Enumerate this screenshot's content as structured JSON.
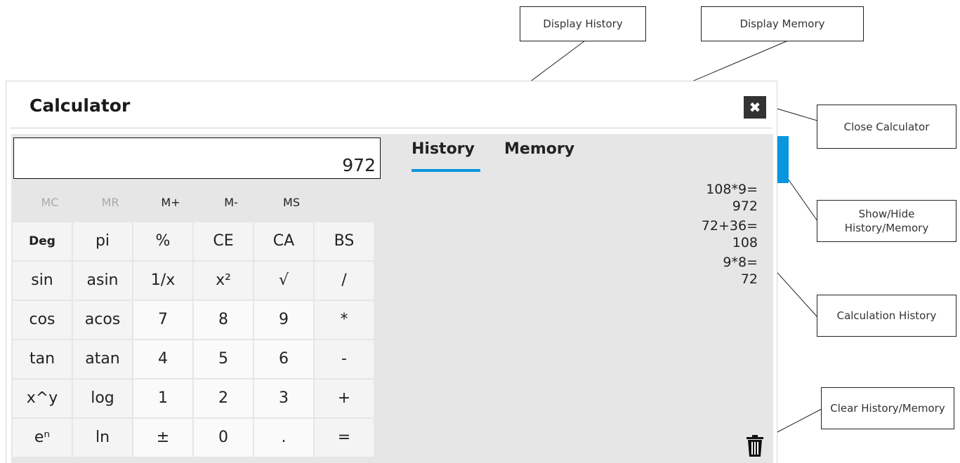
{
  "window": {
    "title": "Calculator",
    "close_symbol": "✖"
  },
  "display": {
    "value": "972"
  },
  "memory_buttons": [
    {
      "label": "MC",
      "enabled": false
    },
    {
      "label": "MR",
      "enabled": false
    },
    {
      "label": "M+",
      "enabled": true
    },
    {
      "label": "M-",
      "enabled": true
    },
    {
      "label": "MS",
      "enabled": true
    }
  ],
  "keys": [
    [
      "Deg",
      "pi",
      "%",
      "CE",
      "CA",
      "BS"
    ],
    [
      "sin",
      "asin",
      "1/x",
      "x²",
      "√",
      "/"
    ],
    [
      "cos",
      "acos",
      "7",
      "8",
      "9",
      "*"
    ],
    [
      "tan",
      "atan",
      "4",
      "5",
      "6",
      "-"
    ],
    [
      "x^y",
      "log",
      "1",
      "2",
      "3",
      "+"
    ],
    [
      "eⁿ",
      "ln",
      "±",
      "0",
      ".",
      "="
    ]
  ],
  "tabs": {
    "history": "History",
    "memory": "Memory",
    "active": "history"
  },
  "history": [
    {
      "expr": "108*9=",
      "result": "972"
    },
    {
      "expr": "72+36=",
      "result": "108"
    },
    {
      "expr": "9*8=",
      "result": "72"
    }
  ],
  "icons": {
    "close": "close-icon",
    "trash": "trash-icon"
  },
  "colors": {
    "accent": "#0a96de",
    "panel": "#e6e6e6",
    "close_bg": "#333333"
  },
  "callouts": {
    "display_history": "Display History",
    "display_memory": "Display Memory",
    "close_calculator": "Close Calculator",
    "show_hide": "Show/Hide History/Memory",
    "calculation_history": "Calculation History",
    "clear": "Clear History/Memory"
  }
}
